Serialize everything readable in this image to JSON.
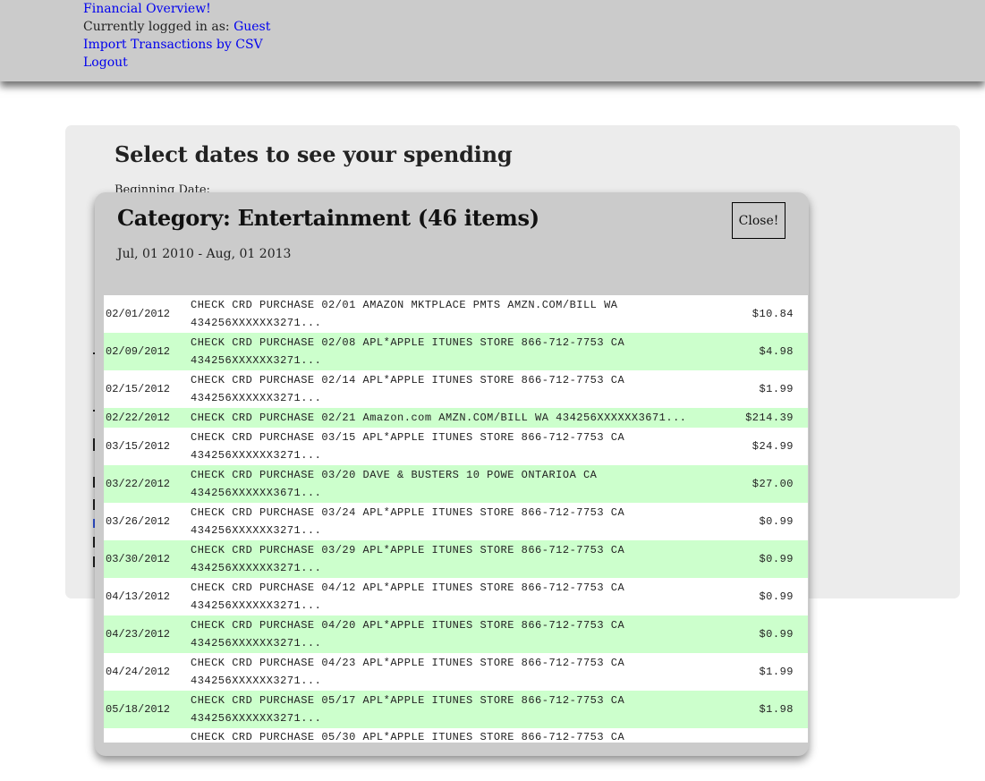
{
  "header": {
    "links": {
      "financial_overview": "Financial Overview!",
      "logged_in_prefix": "Currently logged in as: ",
      "guest": "Guest",
      "import_csv": "Import Transactions by CSV",
      "logout": "Logout"
    }
  },
  "panel": {
    "title": "Select dates to see your spending",
    "beginning_date_label": "Beginning Date:"
  },
  "modal": {
    "title": "Category: Entertainment (46 items)",
    "date_range": "Jul, 01 2010 - Aug, 01 2013",
    "close_label": "Close!",
    "transactions": [
      {
        "date": "02/01/2012",
        "description": "CHECK CRD PURCHASE 02/01 AMAZON MKTPLACE PMTS AMZN.COM/BILL WA 434256XXXXXX3271...",
        "amount": "$10.84"
      },
      {
        "date": "02/09/2012",
        "description": "CHECK CRD PURCHASE 02/08 APL*APPLE ITUNES STORE 866-712-7753 CA 434256XXXXXX3271...",
        "amount": "$4.98"
      },
      {
        "date": "02/15/2012",
        "description": "CHECK CRD PURCHASE 02/14 APL*APPLE ITUNES STORE 866-712-7753 CA 434256XXXXXX3271...",
        "amount": "$1.99"
      },
      {
        "date": "02/22/2012",
        "description": "CHECK CRD PURCHASE 02/21 Amazon.com AMZN.COM/BILL WA 434256XXXXXX3671...",
        "amount": "$214.39"
      },
      {
        "date": "03/15/2012",
        "description": "CHECK CRD PURCHASE 03/15 APL*APPLE ITUNES STORE 866-712-7753 CA 434256XXXXXX3271...",
        "amount": "$24.99"
      },
      {
        "date": "03/22/2012",
        "description": "CHECK CRD PURCHASE 03/20 DAVE & BUSTERS 10 POWE ONTARIOA CA 434256XXXXXX3671...",
        "amount": "$27.00"
      },
      {
        "date": "03/26/2012",
        "description": "CHECK CRD PURCHASE 03/24 APL*APPLE ITUNES STORE 866-712-7753 CA 434256XXXXXX3271...",
        "amount": "$0.99"
      },
      {
        "date": "03/30/2012",
        "description": "CHECK CRD PURCHASE 03/29 APL*APPLE ITUNES STORE 866-712-7753 CA 434256XXXXXX3271...",
        "amount": "$0.99"
      },
      {
        "date": "04/13/2012",
        "description": "CHECK CRD PURCHASE 04/12 APL*APPLE ITUNES STORE 866-712-7753 CA 434256XXXXXX3271...",
        "amount": "$0.99"
      },
      {
        "date": "04/23/2012",
        "description": "CHECK CRD PURCHASE 04/20 APL*APPLE ITUNES STORE 866-712-7753 CA 434256XXXXXX3271...",
        "amount": "$0.99"
      },
      {
        "date": "04/24/2012",
        "description": "CHECK CRD PURCHASE 04/23 APL*APPLE ITUNES STORE 866-712-7753 CA 434256XXXXXX3271...",
        "amount": "$1.99"
      },
      {
        "date": "05/18/2012",
        "description": "CHECK CRD PURCHASE 05/17 APL*APPLE ITUNES STORE 866-712-7753 CA 434256XXXXXX3271...",
        "amount": "$1.98"
      },
      {
        "date": "",
        "description": "CHECK CRD PURCHASE 05/30 APL*APPLE ITUNES STORE 866-712-7753 CA",
        "amount": ""
      }
    ]
  }
}
